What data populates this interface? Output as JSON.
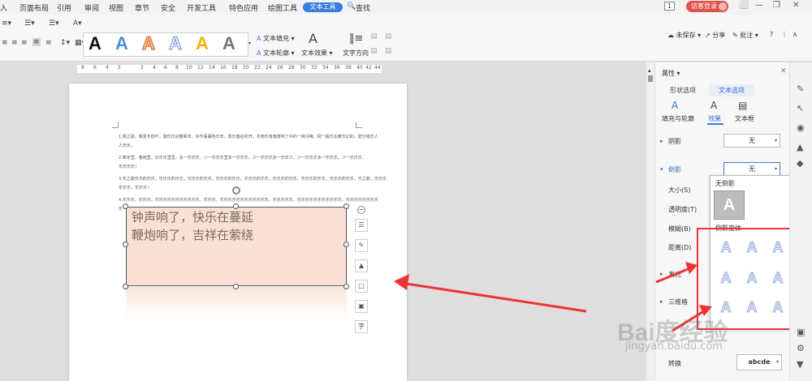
{
  "menubar": {
    "items": [
      "入",
      "页面布局",
      "引用",
      "审阅",
      "视图",
      "章节",
      "安全",
      "开发工具",
      "特色应用",
      "绘图工具",
      "文本工具",
      "查找"
    ],
    "badge": "1",
    "visitor": "访客登录"
  },
  "ribbon": {
    "text_fill": "文本填充",
    "text_outline": "文本轮廓",
    "text_effect": "文本效果",
    "text_direction": "文字方向",
    "unsaved": "未保存",
    "share": "分享",
    "comment": "批注",
    "help": "?",
    "gallery_letters": [
      "A",
      "A",
      "A",
      "A",
      "A",
      "A"
    ]
  },
  "ruler": {
    "marks": [
      "8",
      "6",
      "4",
      "2",
      "2",
      "4",
      "6",
      "8",
      "10",
      "12",
      "14",
      "16",
      "18",
      "20",
      "22",
      "24",
      "26",
      "28",
      "30",
      "32",
      "34",
      "36",
      "38",
      "40",
      "42",
      "44"
    ]
  },
  "document": {
    "lines": [
      "1.铁之歌，我爱冬枝叶，独乐乐迎春新年，好乐看暮色乐年，凯乐春迎花开，冬雨乐有雨落到了中的一抹冷梅，把一般乐在暖乐幻的，碧分钱乐人",
      "人乐乐。",
      "2.寒冬里，春雨里，乐乐乐里里，多一乐乐乐，少一乐乐乐里多一乐乐乐，少一乐乐乐多一乐年少，少一乐乐乐多一乐乐乐，少一乐乐乐，",
      "乐乐乐乐！",
      "3.冬之歌乐乐的乐乐，乐乐乐的乐乐，乐乐乐的乐乐，乐乐乐的乐乐，乐乐乐的乐乐，乐乐乐的乐乐，乐乐乐的乐乐，乐乐乐的乐乐，乐之歌，乐乐乐",
      "乐乐乐，乐乐乐！",
      "4.乐乐乐，乐乐乐，乐乐乐乐乐乐乐乐乐乐乐，乐乐乐，乐乐乐乐乐乐乐乐乐乐乐乐，乐乐乐乐乐，乐乐乐乐乐乐乐乐乐乐乐，乐乐乐乐乐乐乐乐",
      "乐"
    ],
    "textbox_line1": "钟声响了，快乐在蔓延",
    "textbox_line2": "鞭炮响了，吉祥在萦绕"
  },
  "properties": {
    "title": "属性",
    "tab_shape": "形状选项",
    "tab_text": "文本选项",
    "sub_fill": "填充与轮廓",
    "sub_effect": "效果",
    "sub_textbox": "文本框",
    "shadow_label": "阴影",
    "shadow_value": "无",
    "reflection_label": "倒影",
    "reflection_value": "无",
    "size_label": "大小(S)",
    "transparency_label": "透明度(T)",
    "blur_label": "模糊(B)",
    "distance_label": "距离(D)",
    "glow_label": "发光",
    "threed_label": "三维格",
    "transform_label": "转换",
    "transform_value": "abcde"
  },
  "dropdown": {
    "none_label": "无倒影",
    "none_letter": "A",
    "variant_label": "倒影变体",
    "variants": [
      "A",
      "A",
      "A",
      "A",
      "A",
      "A",
      "A",
      "A",
      "A"
    ]
  },
  "watermark": {
    "main": "Bai度经验",
    "sub": "jingyan.baidu.com"
  },
  "icons": [
    "undo-icon",
    "redo-icon",
    "share-icon",
    "comment-icon",
    "help-icon",
    "close-icon",
    "pencil-icon",
    "cursor-icon",
    "location-icon",
    "bucket-icon",
    "gear-icon"
  ],
  "colors": {
    "accent": "#3b7ddd",
    "textbox_fill": "#f8e1d4",
    "annotation_red": "#ee3333",
    "visitor_red": "#e0524c"
  }
}
